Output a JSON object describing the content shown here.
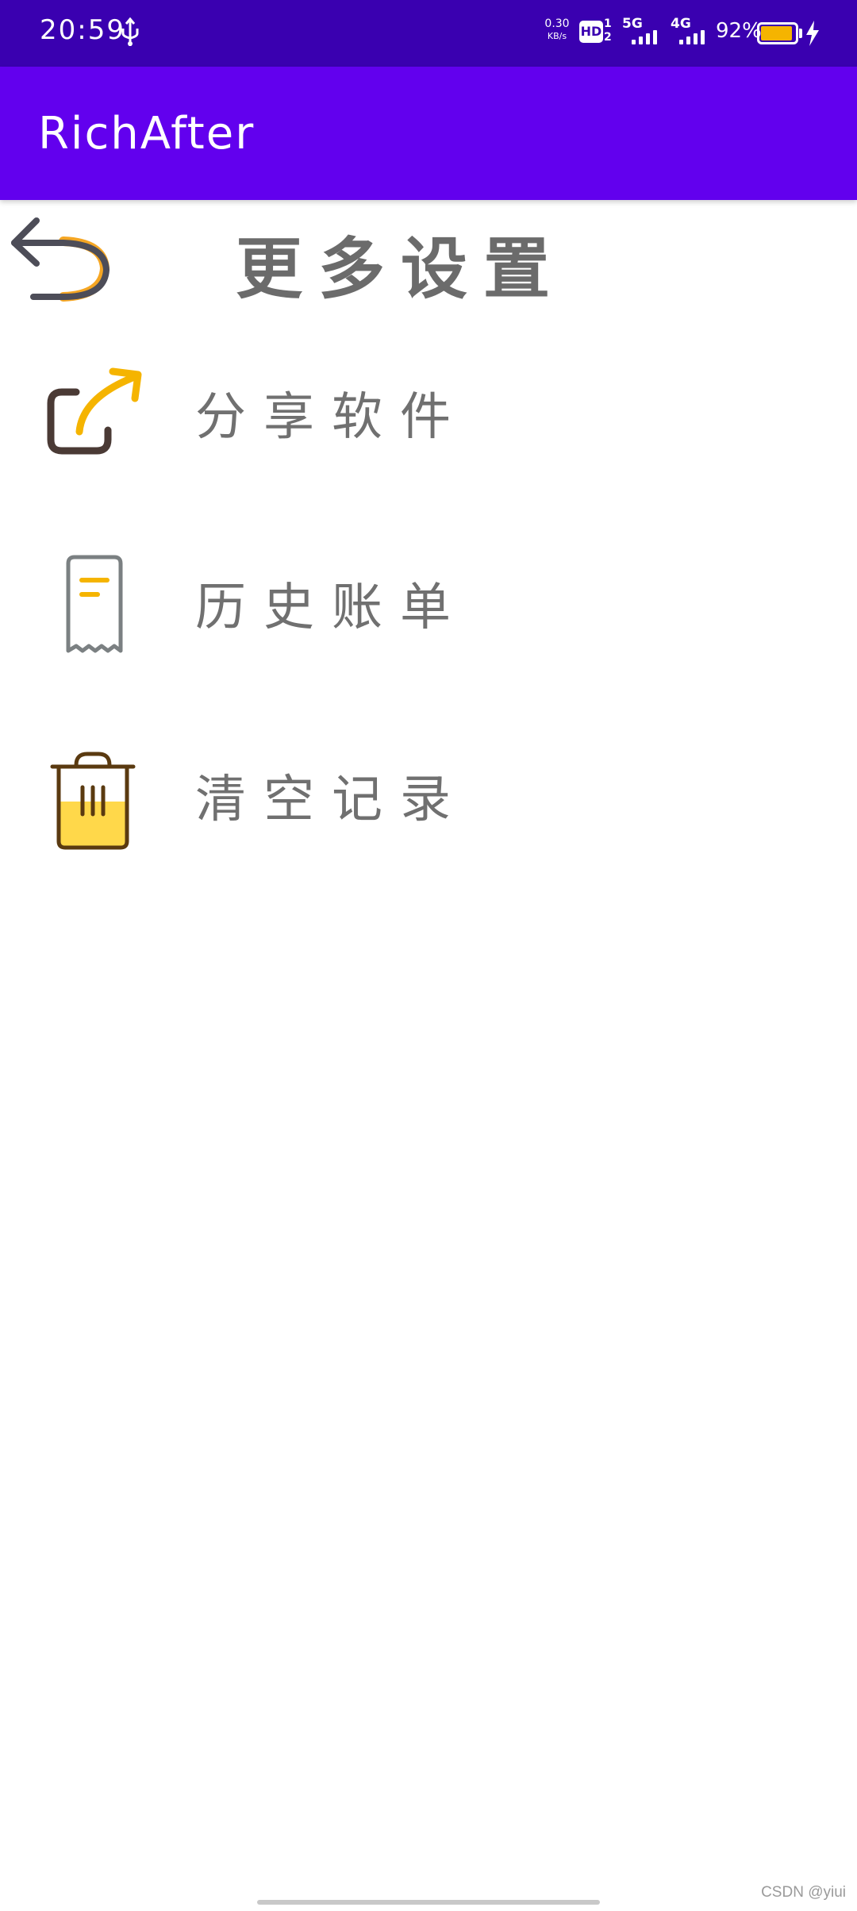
{
  "status_bar": {
    "time": "20:59",
    "net_speed_value": "0.30",
    "net_speed_unit": "KB/s",
    "hd_label": "HD",
    "hd_sim_top": "1",
    "hd_sim_bottom": "2",
    "signal_1_label": "5G",
    "signal_2_label": "4G",
    "battery_percent": "92%",
    "battery_level": 0.92,
    "background_color": "#3a00b0"
  },
  "app_bar": {
    "title": "RichAfter",
    "background_color": "#6200ee"
  },
  "page": {
    "title": "更多设置",
    "back_icon": "undo-arrow-icon"
  },
  "menu": {
    "items": [
      {
        "label": "分享软件",
        "icon": "share-icon"
      },
      {
        "label": "历史账单",
        "icon": "receipt-icon"
      },
      {
        "label": "清空记录",
        "icon": "trash-icon"
      }
    ]
  },
  "watermark": "CSDN @yiui",
  "colors": {
    "accent_yellow": "#f5b400",
    "icon_dark": "#4a3a35",
    "text_gray": "#707070"
  }
}
